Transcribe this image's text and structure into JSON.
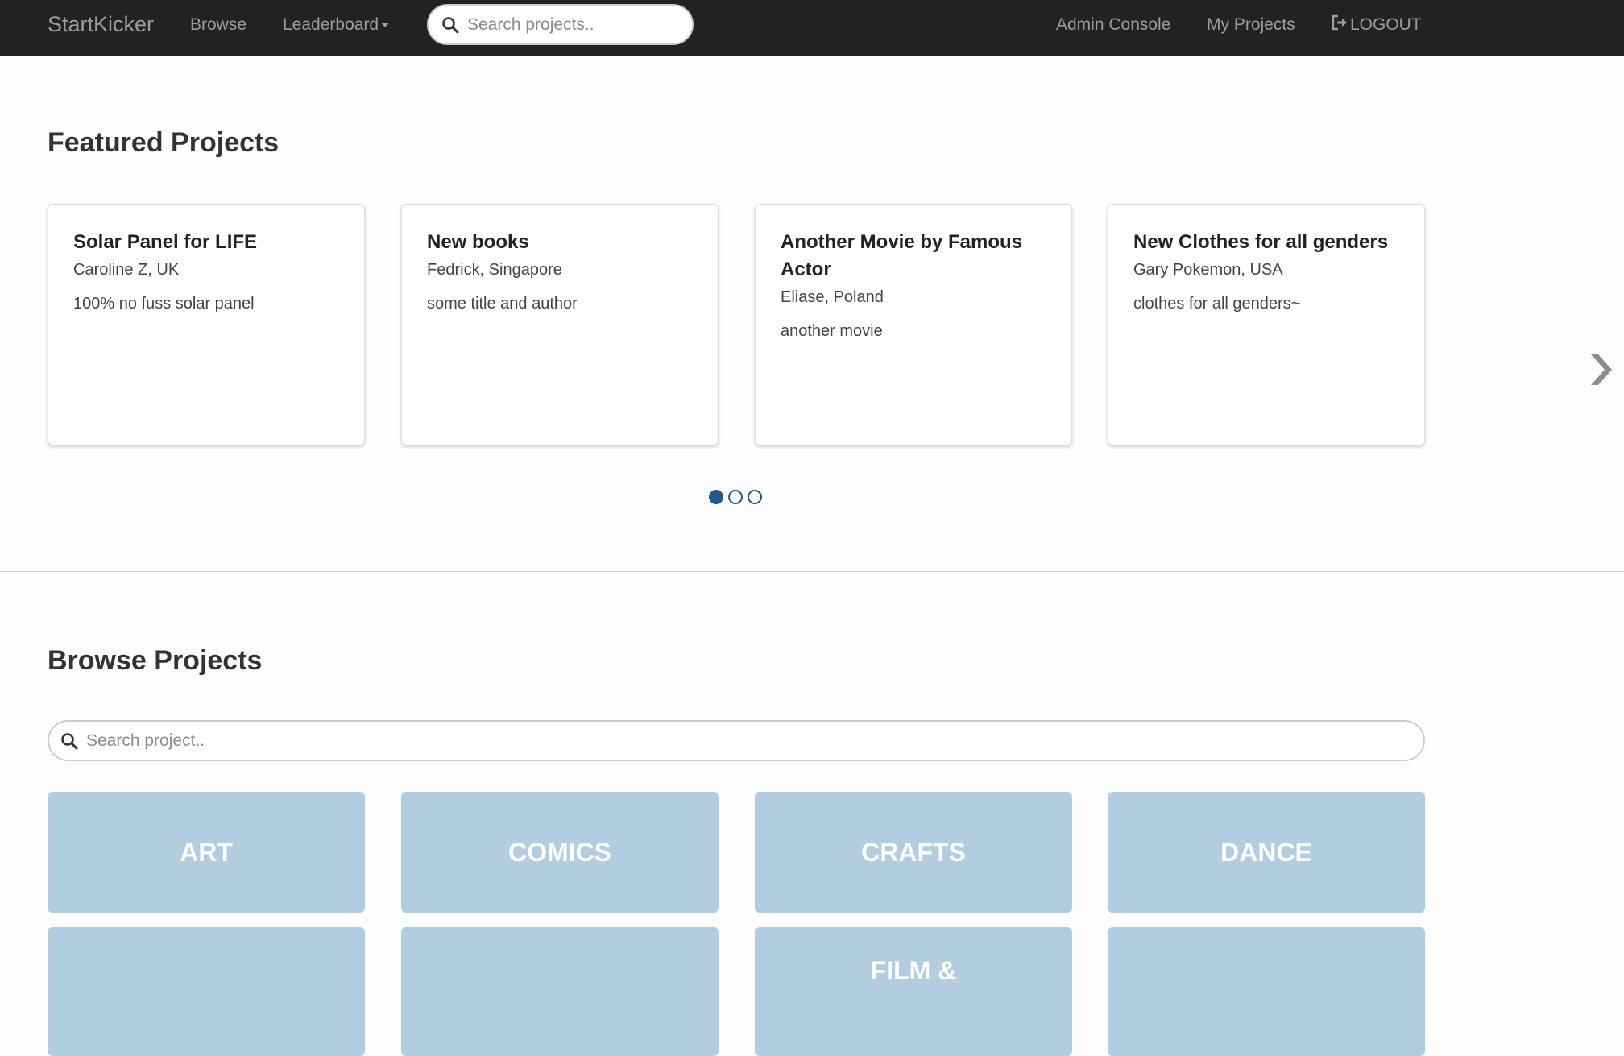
{
  "navbar": {
    "brand": "StartKicker",
    "browse": "Browse",
    "leaderboard": "Leaderboard",
    "search_placeholder": "Search projects..",
    "admin_console": "Admin Console",
    "my_projects": "My Projects",
    "logout": "LOGOUT"
  },
  "featured": {
    "title": "Featured Projects",
    "projects": [
      {
        "title": "Solar Panel for LIFE",
        "owner": "Caroline Z, UK",
        "description": "100% no fuss solar panel"
      },
      {
        "title": "New books",
        "owner": "Fedrick, Singapore",
        "description": "some title and author"
      },
      {
        "title": "Another Movie by Famous Actor",
        "owner": "Eliase, Poland",
        "description": "another movie"
      },
      {
        "title": "New Clothes for all genders",
        "owner": "Gary Pokemon, USA",
        "description": "clothes for all genders~"
      }
    ],
    "carousel": {
      "pages": 3,
      "active_page": 1
    }
  },
  "browse": {
    "title": "Browse Projects",
    "search_placeholder": "Search project..",
    "categories": [
      {
        "label": "ART"
      },
      {
        "label": "COMICS"
      },
      {
        "label": "CRAFTS"
      },
      {
        "label": "DANCE"
      },
      {
        "label": ""
      },
      {
        "label": ""
      },
      {
        "label": "FILM &"
      },
      {
        "label": ""
      }
    ]
  },
  "colors": {
    "navbar_bg": "#222222",
    "nav_text": "#9d9d9d",
    "category_tile": "#b3cde0",
    "dot_accent": "#1a5b8c"
  },
  "icons": {
    "search": "search-icon",
    "logout": "logout-icon",
    "next": "chevron-right-icon"
  }
}
